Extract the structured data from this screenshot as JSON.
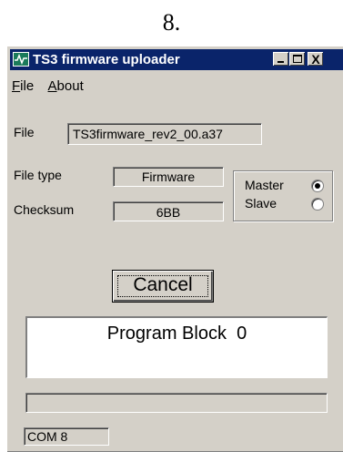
{
  "figure_caption": "8.",
  "window": {
    "title": "TS3 firmware uploader",
    "app_icon": "waveform-icon",
    "controls": {
      "minimize_icon": "minimize-icon",
      "maximize_icon": "maximize-icon",
      "close_icon": "close-icon",
      "close_glyph": "X"
    }
  },
  "menu": {
    "file_accel": "F",
    "file_rest": "ile",
    "about_accel": "A",
    "about_rest": "bout"
  },
  "file": {
    "label": "File",
    "value": "TS3firmware_rev2_00.a37"
  },
  "file_type": {
    "label": "File type",
    "value": "Firmware"
  },
  "checksum": {
    "label": "Checksum",
    "value": "6BB"
  },
  "mode": {
    "options": [
      {
        "label": "Master",
        "selected": true
      },
      {
        "label": "Slave",
        "selected": false
      }
    ]
  },
  "cancel_button": {
    "label": "Cancel"
  },
  "program_status": {
    "text": "Program Block  0"
  },
  "progress": {
    "fraction": 0
  },
  "status_bar": {
    "port": "COM 8"
  }
}
